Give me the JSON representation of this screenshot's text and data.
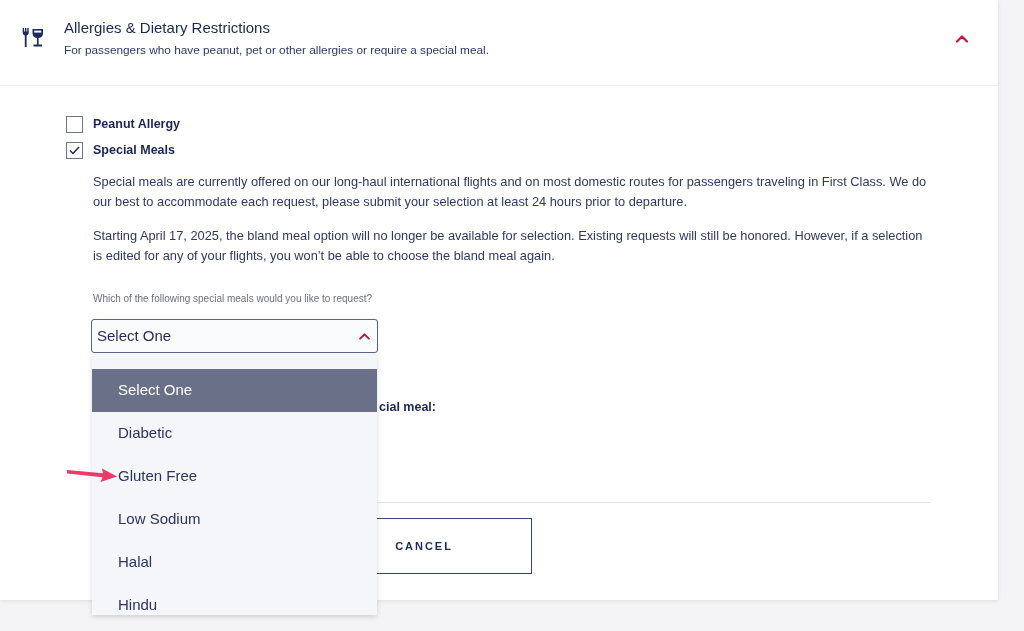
{
  "section": {
    "title": "Allergies & Dietary Restrictions",
    "subtitle": "For passengers who have peanut, pet or other allergies or require a special meal.",
    "expanded": true
  },
  "options": [
    {
      "label": "Peanut Allergy",
      "checked": false
    },
    {
      "label": "Special Meals",
      "checked": true
    }
  ],
  "special_meals": {
    "paragraphs": [
      "Special meals are currently offered on our long-haul international flights and on most domestic routes for passengers traveling in First Class. We do our best to accommodate each request, please submit your selection at least 24 hours prior to departure.",
      "Starting April 17, 2025, the bland meal option will no longer be available for selection. Existing requests will still be honored. However, if a selection is edited for any of your flights, you won’t be able to choose the bland meal again."
    ],
    "question": "Which of the following special meals would you like to request?",
    "select": {
      "value": "Select One",
      "expanded": true,
      "options": [
        {
          "label": "Select One",
          "selected": true,
          "pointed_at": false
        },
        {
          "label": "Diabetic",
          "selected": false,
          "pointed_at": false
        },
        {
          "label": "Gluten Free",
          "selected": false,
          "pointed_at": true
        },
        {
          "label": "Low Sodium",
          "selected": false,
          "pointed_at": false
        },
        {
          "label": "Halal",
          "selected": false,
          "pointed_at": false
        },
        {
          "label": "Hindu",
          "selected": false,
          "pointed_at": false
        }
      ]
    },
    "partial_label": "cial meal:"
  },
  "buttons": [
    {
      "label": "CANCEL"
    }
  ]
}
